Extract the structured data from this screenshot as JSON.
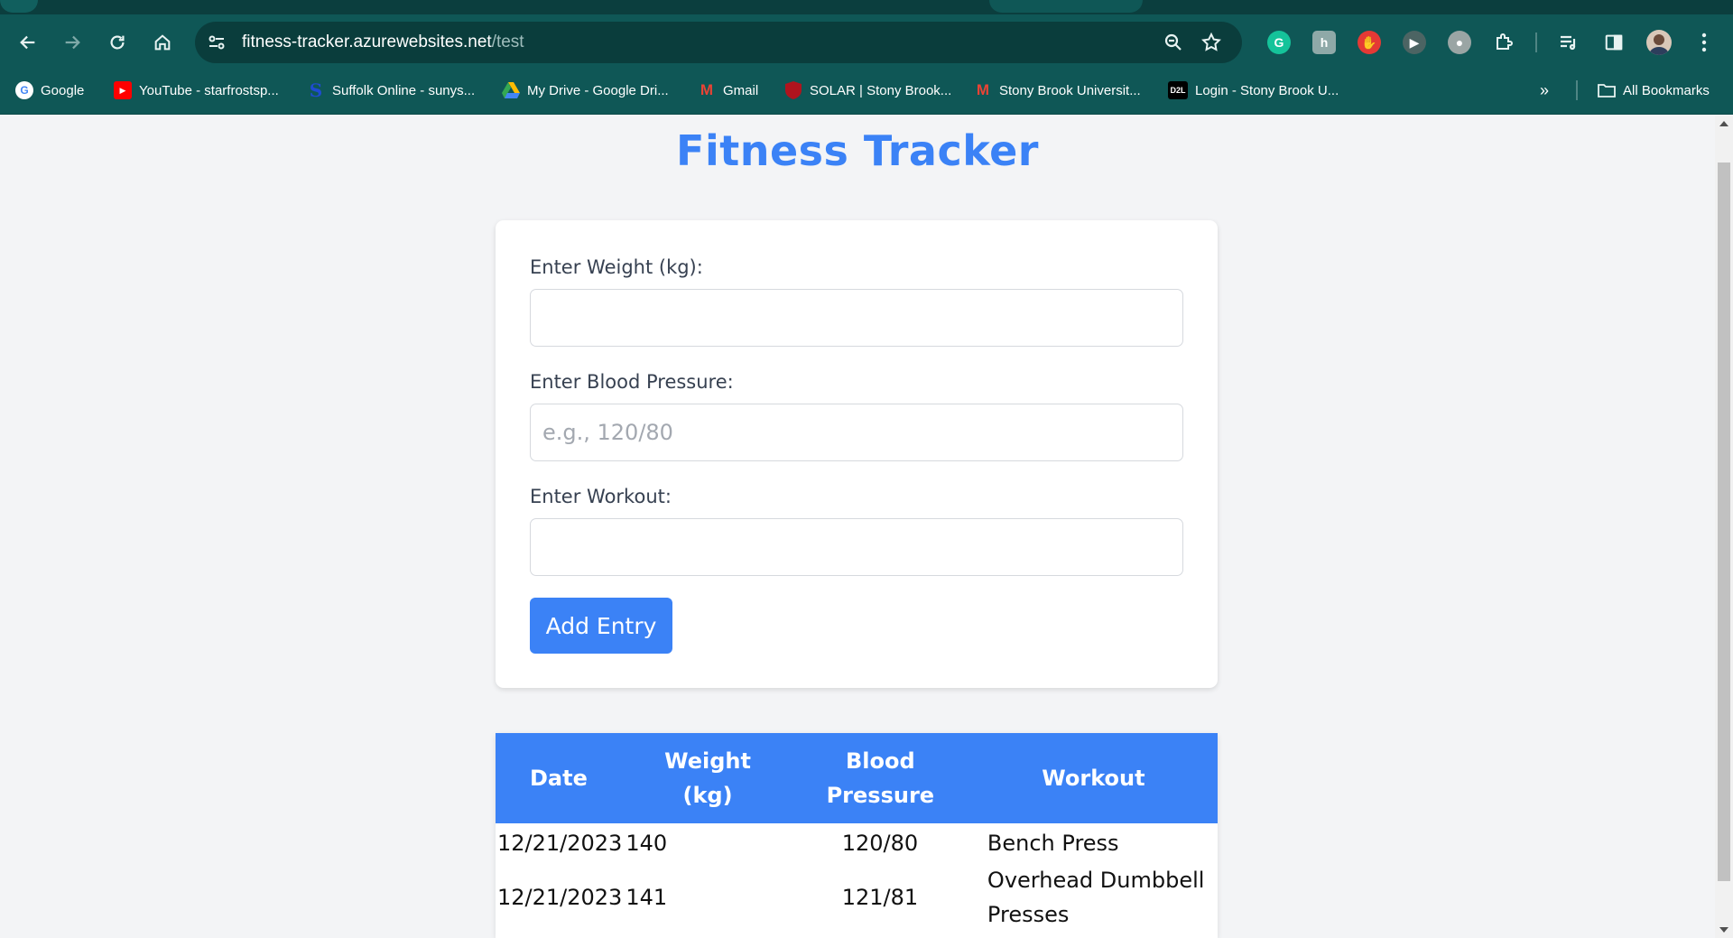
{
  "browser": {
    "url_host": "fitness-tracker.azurewebsites.net",
    "url_path": "/test",
    "bookmarks": [
      {
        "label": "Google",
        "icon": "google-icon"
      },
      {
        "label": "YouTube - starfrostsp...",
        "icon": "youtube-icon"
      },
      {
        "label": "Suffolk Online - sunys...",
        "icon": "suffolk-icon"
      },
      {
        "label": "My Drive - Google Dri...",
        "icon": "drive-icon"
      },
      {
        "label": "Gmail",
        "icon": "gmail-icon"
      },
      {
        "label": "SOLAR | Stony Brook...",
        "icon": "shield-icon"
      },
      {
        "label": "Stony Brook Universit...",
        "icon": "gmail-icon"
      },
      {
        "label": "Login - Stony Brook U...",
        "icon": "d2l-icon"
      }
    ],
    "all_bookmarks_label": "All Bookmarks",
    "d2l_text": "D2L"
  },
  "app": {
    "title": "Fitness Tracker",
    "accent_color": "#3b82f6"
  },
  "form": {
    "weight_label": "Enter Weight (kg):",
    "weight_value": "",
    "bp_label": "Enter Blood Pressure:",
    "bp_placeholder": "e.g., 120/80",
    "workout_label": "Enter Workout:",
    "workout_value": "",
    "submit_label": "Add Entry"
  },
  "table": {
    "headers": {
      "date": "Date",
      "weight_line1": "Weight",
      "weight_line2": "(kg)",
      "bp_line1": "Blood",
      "bp_line2": "Pressure",
      "workout": "Workout"
    },
    "rows": [
      {
        "date": "12/21/2023",
        "weight": "140",
        "bp": "120/80",
        "workout": "Bench Press"
      },
      {
        "date": "12/21/2023",
        "weight": "141",
        "bp": "121/81",
        "workout": "Overhead Dumbbell Presses"
      }
    ]
  }
}
